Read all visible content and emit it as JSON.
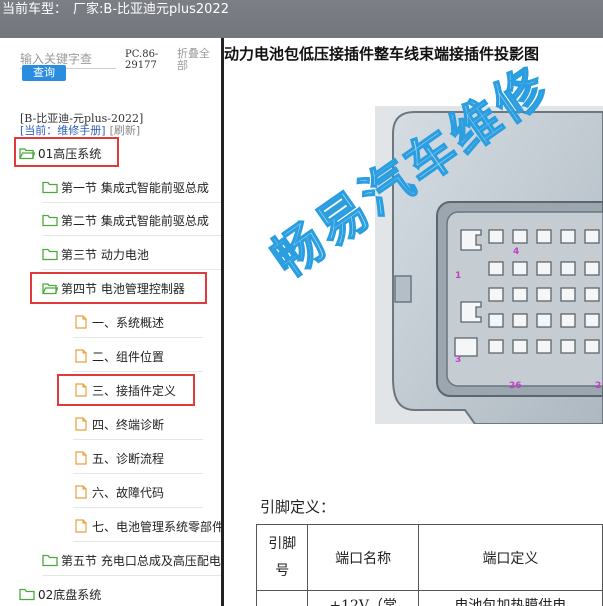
{
  "header": {
    "car_type_label": "当前车型：",
    "manufacturer_label": "厂家:",
    "car_model": "B-比亚迪元plus2022"
  },
  "sidebar": {
    "search_placeholder": "输入关键字查",
    "query_button": "查询",
    "pc_info": "PC.86-29177",
    "collapse_all": "折叠全部",
    "vehicle_name": "[B-比亚迪-元plus-2022]",
    "current_manual": "[当前：维修手册]",
    "refresh": "[刷新]",
    "tree": {
      "root1": "01高压系统",
      "s1": "第一节 集成式智能前驱总成",
      "s2": "第二节 集成式智能前驱总成",
      "s3": "第三节 动力电池",
      "s4": "第四节 电池管理控制器",
      "d1": "一、系统概述",
      "d2": "二、组件位置",
      "d3": "三、接插件定义",
      "d4": "四、终端诊断",
      "d5": "五、诊断流程",
      "d6": "六、故障代码",
      "d7": "七、电池管理系统零部件",
      "s5": "第五节 充电口总成及高压配电",
      "root2": "02底盘系统"
    }
  },
  "content": {
    "title": "动力电池包低压接插件整车线束端接插件投影图",
    "pin_labels": [
      "1",
      "3",
      "4",
      "26",
      "2"
    ],
    "watermark": "畅易汽车维修",
    "pin_def_title": "引脚定义：",
    "table": {
      "col1": "引脚号",
      "col2": "端口名称",
      "col3": "端口定义",
      "row1_name": "+12V（常",
      "row1_def": "电池包加热膜供电"
    }
  },
  "colors": {
    "topbar_bg": "#7c7f86",
    "query_button_bg": "#2b8de0",
    "highlight_border": "#e03a3a",
    "folder_icon": "#4caa3c",
    "doc_icon": "#e9a23b",
    "pin_label": "#c13fc9",
    "watermark": "#2a9ee0"
  },
  "icons": {
    "folder": "folder-icon",
    "document": "document-icon"
  }
}
